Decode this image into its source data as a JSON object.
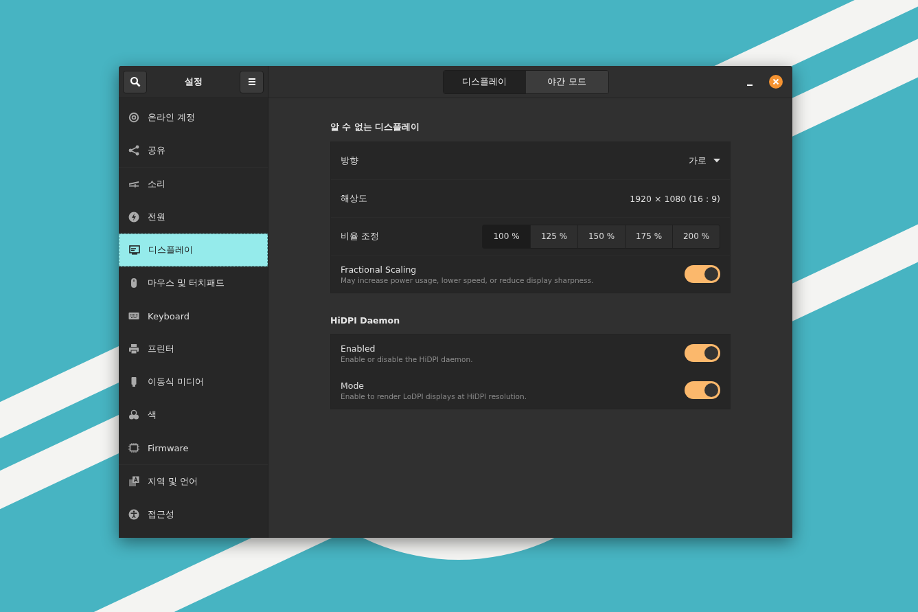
{
  "window": {
    "title": "설정"
  },
  "view_switcher": [
    {
      "label": "디스플레이",
      "selected": true
    },
    {
      "label": "야간 모드",
      "selected": false
    }
  ],
  "sidebar": {
    "groups": [
      {
        "items": [
          {
            "label": "온라인 계정",
            "selected": false
          },
          {
            "label": "공유",
            "selected": false
          }
        ]
      },
      {
        "items": [
          {
            "label": "소리",
            "selected": false
          },
          {
            "label": "전원",
            "selected": false
          },
          {
            "label": "디스플레이",
            "selected": true
          },
          {
            "label": "마우스 및 터치패드",
            "selected": false
          },
          {
            "label": "Keyboard",
            "selected": false
          },
          {
            "label": "프린터",
            "selected": false
          },
          {
            "label": "이동식 미디어",
            "selected": false
          },
          {
            "label": "색",
            "selected": false
          },
          {
            "label": "Firmware",
            "selected": false
          }
        ]
      },
      {
        "items": [
          {
            "label": "지역 및 언어",
            "selected": false
          },
          {
            "label": "접근성",
            "selected": false
          }
        ]
      }
    ]
  },
  "display": {
    "title": "알 수 없는 디스플레이",
    "orientation": {
      "label": "방향",
      "value": "가로"
    },
    "resolution": {
      "label": "해상도",
      "value": "1920 × 1080 (16 : 9)"
    },
    "scale": {
      "label": "비율 조정",
      "options": [
        {
          "label": "100 %",
          "selected": true
        },
        {
          "label": "125 %",
          "selected": false
        },
        {
          "label": "150 %",
          "selected": false
        },
        {
          "label": "175 %",
          "selected": false
        },
        {
          "label": "200 %",
          "selected": false
        }
      ]
    },
    "fractional": {
      "label": "Fractional Scaling",
      "description": "May increase power usage, lower speed, or reduce display sharpness.",
      "on": true
    }
  },
  "hidpi": {
    "title": "HiDPI Daemon",
    "rows": [
      {
        "label": "Enabled",
        "description": "Enable or disable the HiDPI daemon.",
        "on": true
      },
      {
        "label": "Mode",
        "description": "Enable to render LoDPI displays at HiDPI resolution.",
        "on": true
      }
    ]
  }
}
